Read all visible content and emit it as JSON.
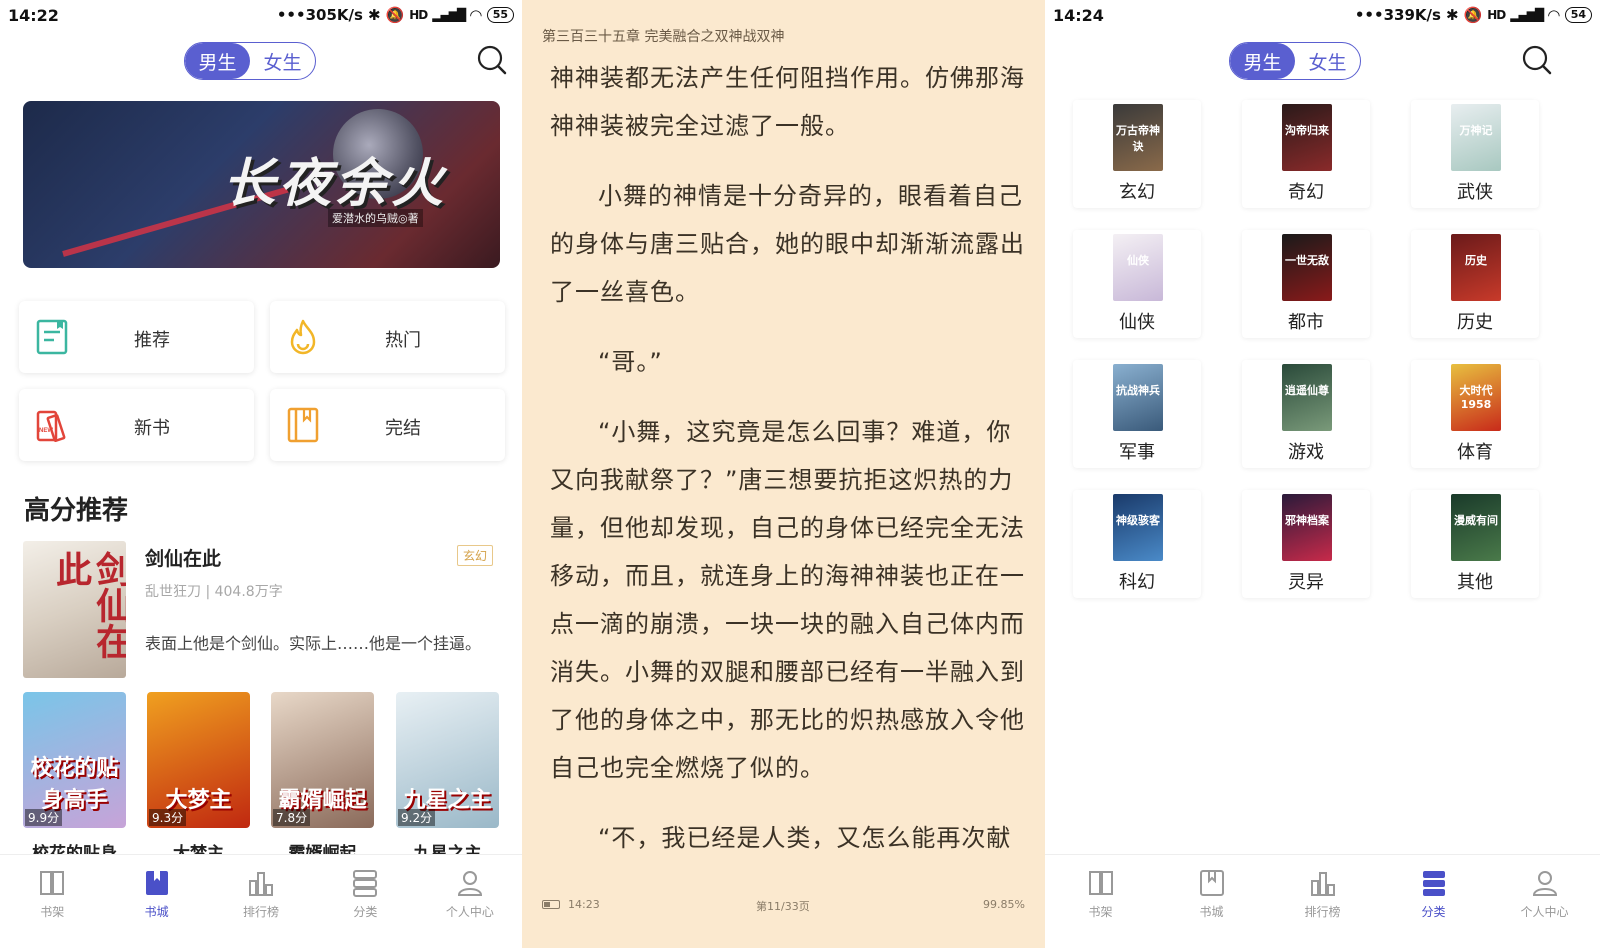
{
  "panel1": {
    "status": {
      "time": "14:22",
      "speed": "•••305K/s",
      "battery": "55",
      "signal": "HD"
    },
    "gender": {
      "male": "男生",
      "female": "女生"
    },
    "banner": {
      "title": "长夜余火",
      "subtitle": "爱潜水的乌贼◎著"
    },
    "tiles": [
      {
        "label": "推荐",
        "icon": "recommend-book-icon"
      },
      {
        "label": "热门",
        "icon": "flame-icon"
      },
      {
        "label": "新书",
        "icon": "new-book-icon"
      },
      {
        "label": "完结",
        "icon": "finished-book-icon"
      }
    ],
    "section_title": "高分推荐",
    "featured": {
      "cover_text": "剑仙在此",
      "title": "剑仙在此",
      "author_meta": "乱世狂刀 | 404.8万字",
      "description": "表面上他是个剑仙。实际上……他是一个挂逼。",
      "tag": "玄幻"
    },
    "minis": [
      {
        "cover_text": "校花的贴身高手",
        "score": "9.9分",
        "name": "校花的贴身",
        "color1": "#7ac5e8",
        "color2": "#c7a3d8"
      },
      {
        "cover_text": "大梦主",
        "score": "9.3分",
        "name": "大梦主",
        "color1": "#f0a020",
        "color2": "#c02810"
      },
      {
        "cover_text": "霸婿崛起",
        "score": "7.8分",
        "name": "霸婿崛起",
        "color1": "#e8d8c8",
        "color2": "#8a6a5a"
      },
      {
        "cover_text": "九星之主",
        "score": "9.2分",
        "name": "九星之主",
        "color1": "#e8f0f4",
        "color2": "#9ab8c8"
      }
    ]
  },
  "reader": {
    "chapter": "第三百三十五章 完美融合之双神战双神",
    "paragraphs": [
      {
        "text": "神神装都无法产生任何阻挡作用。仿佛那海神神装被完全过滤了一般。",
        "indent": false
      },
      {
        "text": "小舞的神情是十分奇异的，眼看着自己的身体与唐三贴合，她的眼中却渐渐流露出了一丝喜色。",
        "indent": true
      },
      {
        "text": "“哥。”",
        "indent": true
      },
      {
        "text": "“小舞，这究竟是怎么回事？难道，你又向我献祭了？”唐三想要抗拒这炽热的力量，但他却发现，自己的身体已经完全无法移动，而且，就连身上的海神神装也正在一点一滴的崩溃，一块一块的融入自己体内而消失。小舞的双腿和腰部已经有一半融入到了他的身体之中，那无比的炽热感放入令他自己也完全燃烧了似的。",
        "indent": true
      },
      {
        "text": "“不，我已经是人类，又怎么能再次献",
        "indent": true
      }
    ],
    "footer": {
      "time": "14:23",
      "page": "第11/33页",
      "percent": "99.85%"
    }
  },
  "panel3": {
    "status": {
      "time": "14:24",
      "speed": "•••339K/s",
      "battery": "54",
      "signal": "HD"
    },
    "gender": {
      "male": "男生",
      "female": "女生"
    },
    "categories": [
      {
        "label": "玄幻",
        "cover": "万古帝神诀",
        "c1": "#3a3a3a",
        "c2": "#8a6a4a"
      },
      {
        "label": "奇幻",
        "cover": "沟帝归来",
        "c1": "#2a1a1a",
        "c2": "#8a2a2a"
      },
      {
        "label": "武侠",
        "cover": "万神记",
        "c1": "#e8eef0",
        "c2": "#a8c8c0"
      },
      {
        "label": "仙侠",
        "cover": "仙侠",
        "c1": "#f4f0f4",
        "c2": "#c8b8d8"
      },
      {
        "label": "都市",
        "cover": "一世无敌",
        "c1": "#1a1a1a",
        "c2": "#8a1a1a"
      },
      {
        "label": "历史",
        "cover": "历史",
        "c1": "#6a1a1a",
        "c2": "#c83a2a"
      },
      {
        "label": "军事",
        "cover": "抗战神兵",
        "c1": "#8ab0d0",
        "c2": "#3a5a7a"
      },
      {
        "label": "游戏",
        "cover": "逍遥仙尊",
        "c1": "#2a4a3a",
        "c2": "#7a9a7a"
      },
      {
        "label": "体育",
        "cover": "大时代1958",
        "c1": "#e8c040",
        "c2": "#c82a1a"
      },
      {
        "label": "科幻",
        "cover": "神级骇客",
        "c1": "#1a3a6a",
        "c2": "#4a8ac8"
      },
      {
        "label": "灵异",
        "cover": "邪神档案",
        "c1": "#2a1a3a",
        "c2": "#c82a4a"
      },
      {
        "label": "其他",
        "cover": "漫威有间",
        "c1": "#1a3a2a",
        "c2": "#4a7a4a"
      }
    ]
  },
  "nav_labels": [
    "书架",
    "书城",
    "排行榜",
    "分类",
    "个人中心"
  ],
  "colors": {
    "accent": "#5a5fd0",
    "reader_bg": "#fbe9cf",
    "tag": "#d4a24a"
  }
}
